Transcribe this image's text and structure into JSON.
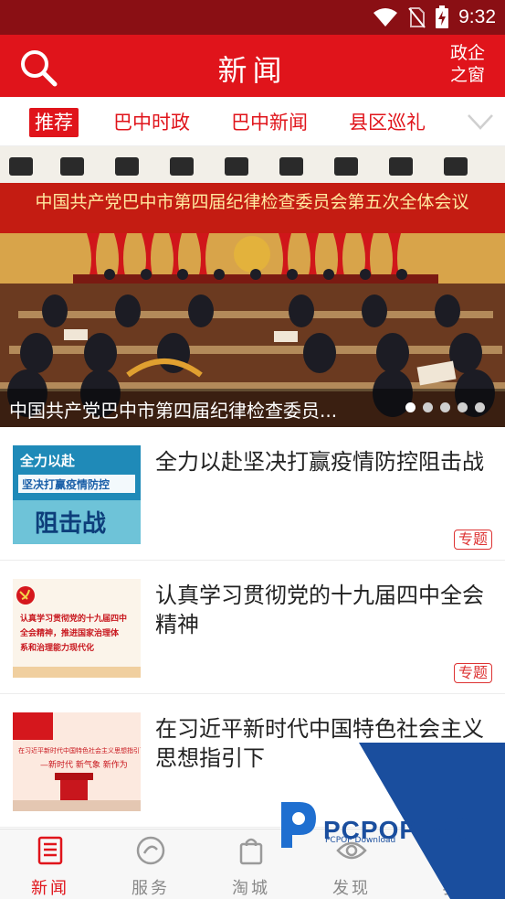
{
  "status": {
    "time": "9:32",
    "icons": [
      "wifi-icon",
      "no-sim-icon",
      "battery-charging-icon"
    ]
  },
  "header": {
    "title": "新闻",
    "right_line1": "政企",
    "right_line2": "之窗",
    "colors": {
      "bar": "#e0141b",
      "status_bar": "#8a0f14"
    }
  },
  "tabs": [
    {
      "label": "推荐",
      "active": true
    },
    {
      "label": "巴中时政",
      "active": false
    },
    {
      "label": "巴中新闻",
      "active": false
    },
    {
      "label": "县区巡礼",
      "active": false
    }
  ],
  "banner": {
    "caption": "中国共产党巴中市第四届纪律检查委员...",
    "hall_banner": "中国共产党巴中市第四届纪律检查委员会第五次全体会议",
    "slide_count": 5,
    "active_slide": 1
  },
  "news": [
    {
      "title": "全力以赴坚决打赢疫情防控阻击战",
      "tag": "专题",
      "thumb": {
        "line1": "全力以赴",
        "line2": "坚决打赢疫情防控",
        "line3": "阻击战"
      }
    },
    {
      "title": "认真学习贯彻党的十九届四中全会精神",
      "tag": "专题",
      "thumb": {
        "line1": "认真学习贯彻党的十九届四中",
        "line2": "全会精神，推进国家治理体",
        "line3": "系和治理能力现代化"
      }
    },
    {
      "title": "在习近平新时代中国特色社会主义思想指引下",
      "tag": "",
      "thumb": {
        "line1": "在习近平新时代中国特色社会主义思想指引下",
        "line2": "—新时代 新气象 新作为"
      }
    }
  ],
  "bottom_nav": [
    {
      "label": "新闻",
      "icon": "newspaper-icon",
      "active": true
    },
    {
      "label": "服务",
      "icon": "service-icon",
      "active": false
    },
    {
      "label": "淘城",
      "icon": "shopping-bag-icon",
      "active": false
    },
    {
      "label": "发现",
      "icon": "discover-eye-icon",
      "active": false
    },
    {
      "label": "我",
      "icon": "profile-icon",
      "active": false
    }
  ],
  "watermark": {
    "text": "PCPOP下载",
    "sub": "PCPOP Download"
  }
}
